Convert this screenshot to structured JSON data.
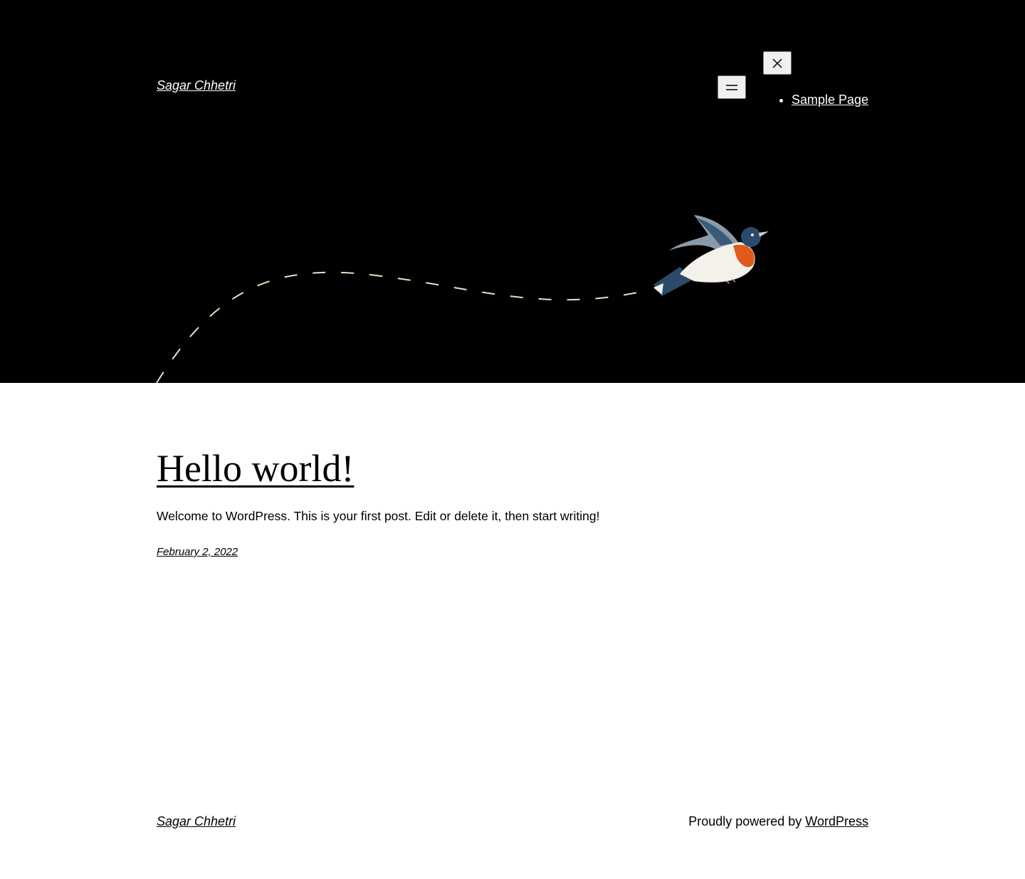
{
  "header": {
    "site_title": "Sagar Chhetri",
    "menu_icon": "hamburger-menu-icon",
    "close_icon": "close-icon",
    "nav": {
      "items": [
        {
          "label": "Sample Page"
        }
      ]
    },
    "background_color": "#000000",
    "path_color": "#f2dcc0",
    "bird_colors": {
      "blue": "#2b4a6a",
      "orange": "#e05a1a",
      "white": "#f4f1ea"
    }
  },
  "post": {
    "title": "Hello world!",
    "excerpt": "Welcome to WordPress. This is your first post. Edit or delete it, then start writing!",
    "date": "February 2, 2022"
  },
  "footer": {
    "site_title": "Sagar Chhetri",
    "credit_prefix": "Proudly powered by ",
    "credit_link": "WordPress"
  }
}
